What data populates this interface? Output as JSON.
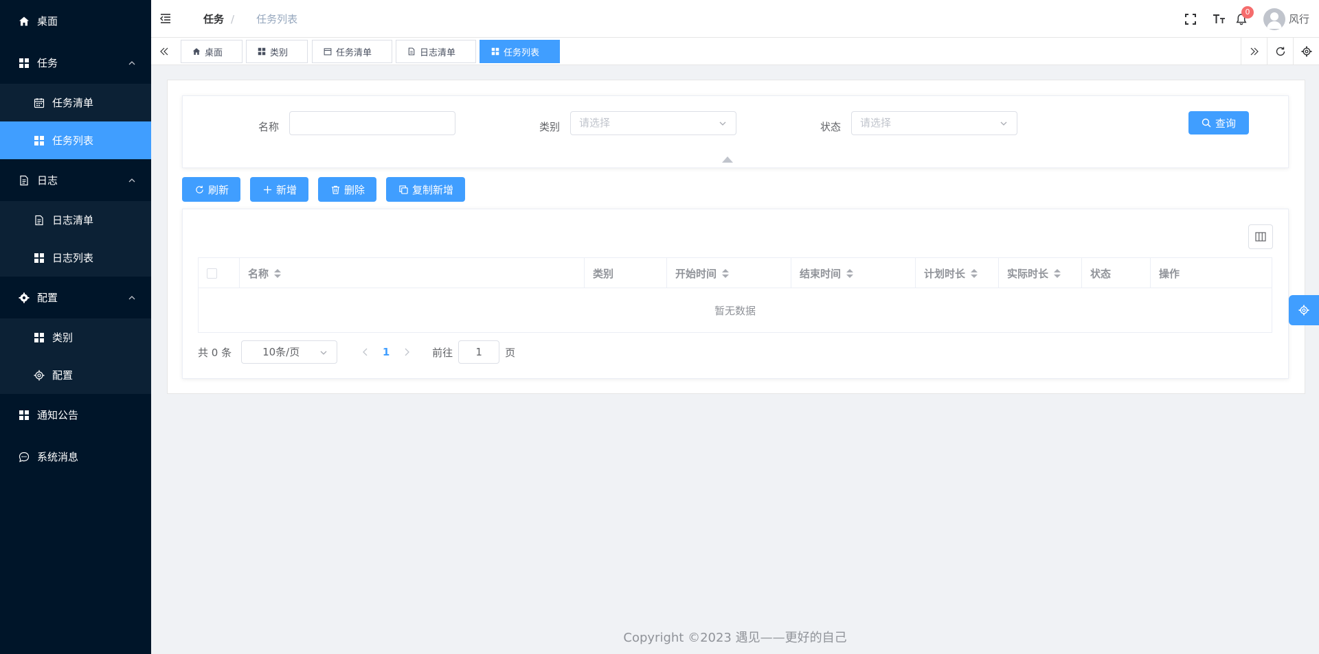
{
  "sidebar": {
    "items": [
      {
        "label": "桌面",
        "icon": "home-icon"
      },
      {
        "label": "任务",
        "icon": "grid-icon",
        "expanded": true,
        "children": [
          {
            "label": "任务清单",
            "icon": "calendar-icon"
          },
          {
            "label": "任务列表",
            "icon": "grid-icon",
            "active": true
          }
        ]
      },
      {
        "label": "日志",
        "icon": "document-icon",
        "expanded": true,
        "children": [
          {
            "label": "日志清单",
            "icon": "document-icon"
          },
          {
            "label": "日志列表",
            "icon": "grid-icon"
          }
        ]
      },
      {
        "label": "配置",
        "icon": "gear-icon",
        "expanded": true,
        "children": [
          {
            "label": "类别",
            "icon": "grid-icon"
          },
          {
            "label": "配置",
            "icon": "gear-icon"
          }
        ]
      },
      {
        "label": "通知公告",
        "icon": "grid-icon"
      },
      {
        "label": "系统消息",
        "icon": "chat-icon"
      }
    ]
  },
  "header": {
    "breadcrumb": {
      "parent": "任务",
      "separator": "/",
      "current": "任务列表"
    },
    "notifications": "0",
    "username": "风行"
  },
  "tabs": [
    {
      "label": "桌面",
      "icon": "home-icon"
    },
    {
      "label": "类别",
      "icon": "grid-icon"
    },
    {
      "label": "任务清单",
      "icon": "calendar-icon"
    },
    {
      "label": "日志清单",
      "icon": "document-icon"
    },
    {
      "label": "任务列表",
      "icon": "grid-icon",
      "active": true
    }
  ],
  "search": {
    "name_label": "名称",
    "name_value": "",
    "category_label": "类别",
    "category_placeholder": "请选择",
    "status_label": "状态",
    "status_placeholder": "请选择",
    "query_label": "查询"
  },
  "toolbar": {
    "refresh_label": "刷新",
    "add_label": "新增",
    "delete_label": "删除",
    "copy_add_label": "复制新增"
  },
  "table": {
    "columns": [
      {
        "label": "名称",
        "sortable": true
      },
      {
        "label": "类别",
        "sortable": false
      },
      {
        "label": "开始时间",
        "sortable": true
      },
      {
        "label": "结束时间",
        "sortable": true
      },
      {
        "label": "计划时长",
        "sortable": true
      },
      {
        "label": "实际时长",
        "sortable": true
      },
      {
        "label": "状态",
        "sortable": false
      },
      {
        "label": "操作",
        "sortable": false
      }
    ],
    "empty_text": "暂无数据"
  },
  "pager": {
    "total_text": "共 0 条",
    "page_size": "10条/页",
    "current_page": "1",
    "goto_prefix": "前往",
    "goto_value": "1",
    "goto_suffix": "页"
  },
  "footer": {
    "text": "Copyright ©2023 遇见——更好的自己"
  },
  "colors": {
    "primary": "#409eff",
    "sidebar_bg": "#001529",
    "danger": "#f56c6c"
  }
}
